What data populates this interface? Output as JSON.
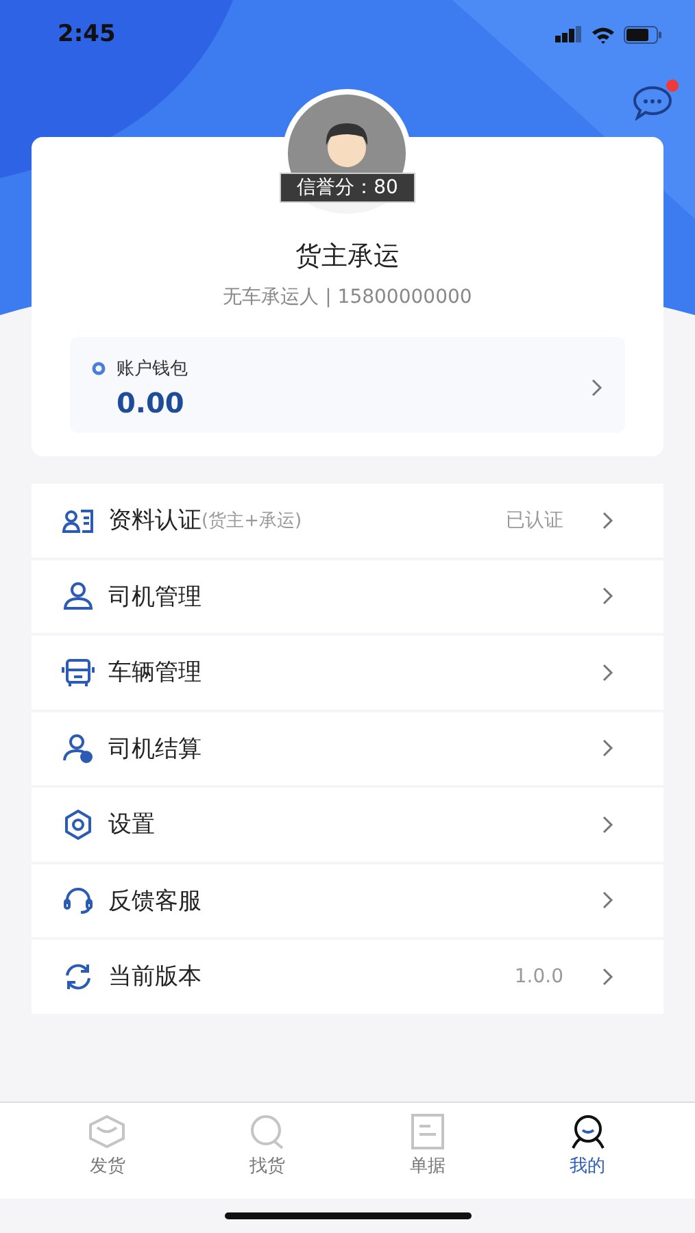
{
  "status_bar": {
    "time": "2:45"
  },
  "profile": {
    "credit": "信誉分：80",
    "name": "货主承运",
    "subtitle": "无车承运人 | 15800000000",
    "has_message": true
  },
  "wallet": {
    "label": "账户钱包",
    "amount": "0.00"
  },
  "menu": [
    {
      "kind": "certify",
      "label": "资料认证",
      "note": "(货主+承运)",
      "value": "已认证"
    },
    {
      "kind": "driver",
      "label": "司机管理"
    },
    {
      "kind": "vehicle",
      "label": "车辆管理"
    },
    {
      "kind": "settle",
      "label": "司机结算"
    },
    {
      "kind": "settings",
      "label": "设置"
    },
    {
      "kind": "service",
      "label": "反馈客服"
    },
    {
      "kind": "version",
      "label": "当前版本",
      "value": "1.0.0"
    }
  ],
  "tabs": [
    {
      "kind": "ship",
      "label": "发货",
      "selected": false
    },
    {
      "kind": "find",
      "label": "找货",
      "selected": false
    },
    {
      "kind": "doc",
      "label": "单据",
      "selected": false
    },
    {
      "kind": "me",
      "label": "我的",
      "selected": true
    }
  ]
}
